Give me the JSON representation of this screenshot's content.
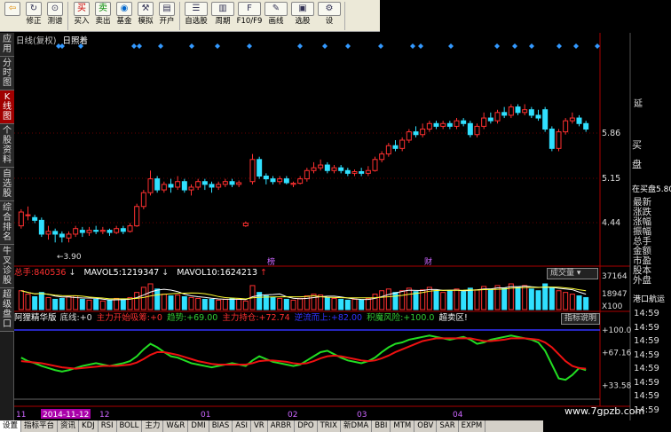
{
  "toolbar": {
    "title": "",
    "groups": [
      [
        {
          "icon": "back",
          "label": ""
        },
        {
          "icon": "forward",
          "label": "修正"
        },
        {
          "icon": "target",
          "label": "测谱"
        }
      ],
      [
        {
          "icon": "buy",
          "label": "买入"
        },
        {
          "icon": "sell",
          "label": "卖出"
        },
        {
          "icon": "fund",
          "label": "基金"
        },
        {
          "icon": "hammer",
          "label": "模拟"
        },
        {
          "icon": "book",
          "label": "开户"
        }
      ],
      [
        {
          "icon": "list",
          "label": "自选股"
        },
        {
          "icon": "bars",
          "label": "周期"
        },
        {
          "icon": "f10",
          "label": "F10/F9"
        },
        {
          "icon": "pen",
          "label": "画线"
        },
        {
          "icon": "screen",
          "label": "选股"
        },
        {
          "icon": "more",
          "label": "设"
        }
      ]
    ]
  },
  "left_tabs": [
    "应用",
    "分时图",
    "K线图",
    "个股资料",
    "自选股",
    "综合排名",
    "牛叉诊股",
    "超级盘口"
  ],
  "chart_header": {
    "period": "日线(复权)",
    "mode": "日照着"
  },
  "price_axis": [
    "5.86",
    "5.15",
    "4.44"
  ],
  "low_label": "3.90",
  "markers": [
    "榜",
    "财"
  ],
  "volume": {
    "label": "总手:",
    "value": "840536",
    "ma5_label": "MAVOL5:",
    "ma5": "1219347",
    "ma10_label": "MAVOL10:",
    "ma10": "1624213",
    "button": "成交量",
    "axis": [
      "37164",
      "18947",
      "X100"
    ]
  },
  "indicator": {
    "name": "阿狸精华版",
    "items": [
      {
        "label": "底线:",
        "value": "+0"
      },
      {
        "label": "主力开始吸筹:",
        "value": "+0"
      },
      {
        "label": "趋势:",
        "value": "+69.00"
      },
      {
        "label": "主力持仓:",
        "value": "+72.74"
      },
      {
        "label": "逆流而上:",
        "value": "+82.00"
      },
      {
        "label": "积魔风险:",
        "value": "+100.0"
      },
      {
        "label": "超卖区!",
        "value": ""
      }
    ],
    "button": "指标说明",
    "axis": [
      "+100.0",
      "+67.16",
      "+33.58"
    ]
  },
  "right_panel": {
    "top": [
      "延",
      "买",
      "盘"
    ],
    "buy_label": "在买盘5.80",
    "items": [
      "最新",
      "涨跌",
      "涨幅",
      "振幅",
      "总手",
      "金额",
      "市盈",
      "股本",
      "外盘"
    ],
    "port": "港口航运",
    "times": [
      "14:59",
      "14:59",
      "14:59",
      "14:59",
      "14:59",
      "14:59",
      "14:59",
      "14:59"
    ]
  },
  "date_axis": {
    "labels": [
      "11",
      "2014-11-12",
      "12",
      "01",
      "02",
      "03",
      "04"
    ]
  },
  "bottom_tabs": [
    "设置",
    "指标平台",
    "资讯",
    "KDJ",
    "RSI",
    "BOLL",
    "主力",
    "W&R",
    "DMI",
    "BIAS",
    "ASI",
    "VR",
    "ARBR",
    "DPO",
    "TRIX",
    "新DMA",
    "BBI",
    "MTM",
    "OBV",
    "SAR",
    "EXPM"
  ],
  "watermark": "www.7gpzb.com",
  "chart_data": {
    "type": "candlestick",
    "price_range": [
      3.6,
      6.6
    ],
    "candles": [
      [
        4.2,
        4.45,
        4.15,
        4.5
      ],
      [
        4.4,
        4.4,
        4.3,
        4.55
      ],
      [
        4.35,
        4.3,
        4.25,
        4.4
      ],
      [
        4.3,
        4.05,
        4.0,
        4.35
      ],
      [
        4.05,
        4.1,
        3.95,
        4.2
      ],
      [
        4.1,
        4.05,
        3.9,
        4.15
      ],
      [
        4.05,
        4.0,
        3.9,
        4.1
      ],
      [
        3.98,
        4.05,
        3.9,
        4.1
      ],
      [
        4.05,
        4.15,
        4.0,
        4.2
      ],
      [
        4.12,
        4.08,
        4.0,
        4.18
      ],
      [
        4.08,
        4.12,
        4.02,
        4.18
      ],
      [
        4.12,
        4.1,
        4.05,
        4.2
      ],
      [
        4.1,
        4.12,
        4.05,
        4.18
      ],
      [
        4.12,
        4.08,
        4.02,
        4.15
      ],
      [
        4.08,
        4.15,
        4.05,
        4.2
      ],
      [
        4.15,
        4.1,
        4.05,
        4.2
      ],
      [
        4.1,
        4.2,
        4.08,
        4.25
      ],
      [
        4.2,
        4.55,
        4.18,
        4.6
      ],
      [
        4.55,
        4.8,
        4.5,
        4.85
      ],
      [
        4.8,
        5.05,
        4.75,
        5.2
      ],
      [
        5.05,
        4.85,
        4.8,
        5.1
      ],
      [
        4.85,
        4.95,
        4.8,
        5.0
      ],
      [
        4.95,
        4.9,
        4.8,
        5.05
      ],
      [
        4.9,
        5.0,
        4.85,
        5.1
      ],
      [
        5.0,
        4.85,
        4.8,
        5.05
      ],
      [
        4.85,
        4.9,
        4.75,
        4.95
      ],
      [
        4.9,
        5.0,
        4.85,
        5.05
      ],
      [
        5.0,
        4.95,
        4.85,
        5.05
      ],
      [
        4.95,
        4.9,
        4.8,
        5.0
      ],
      [
        4.9,
        4.95,
        4.85,
        5.0
      ],
      [
        4.95,
        5.0,
        4.9,
        5.05
      ],
      [
        5.0,
        4.95,
        4.9,
        5.05
      ],
      [
        4.95,
        4.98,
        4.9,
        5.02
      ],
      [
        4.2,
        4.25,
        4.18,
        4.28
      ],
      [
        5.0,
        5.4,
        4.95,
        5.5
      ],
      [
        5.4,
        5.1,
        5.05,
        5.45
      ],
      [
        5.1,
        5.05,
        4.95,
        5.15
      ],
      [
        5.05,
        5.0,
        4.95,
        5.1
      ],
      [
        5.0,
        5.05,
        4.95,
        5.1
      ],
      [
        5.05,
        4.98,
        4.95,
        5.1
      ],
      [
        4.95,
        4.97,
        4.9,
        5.0
      ],
      [
        4.97,
        5.05,
        4.95,
        5.1
      ],
      [
        5.05,
        5.2,
        5.0,
        5.25
      ],
      [
        5.2,
        5.25,
        5.15,
        5.35
      ],
      [
        5.25,
        5.3,
        5.2,
        5.4
      ],
      [
        5.3,
        5.2,
        5.15,
        5.35
      ],
      [
        5.2,
        5.25,
        5.15,
        5.3
      ],
      [
        5.25,
        5.2,
        5.15,
        5.3
      ],
      [
        5.2,
        5.15,
        5.1,
        5.25
      ],
      [
        5.15,
        5.18,
        5.1,
        5.22
      ],
      [
        5.18,
        5.15,
        5.1,
        5.25
      ],
      [
        5.15,
        5.2,
        5.1,
        5.28
      ],
      [
        5.2,
        5.4,
        5.18,
        5.45
      ],
      [
        5.4,
        5.5,
        5.35,
        5.55
      ],
      [
        5.5,
        5.65,
        5.45,
        5.7
      ],
      [
        5.65,
        5.6,
        5.55,
        5.75
      ],
      [
        5.6,
        5.75,
        5.55,
        5.8
      ],
      [
        5.75,
        5.9,
        5.7,
        5.95
      ],
      [
        5.9,
        5.85,
        5.8,
        6.0
      ],
      [
        5.85,
        5.95,
        5.8,
        6.05
      ],
      [
        5.95,
        6.05,
        5.9,
        6.1
      ],
      [
        6.05,
        6.0,
        5.95,
        6.1
      ],
      [
        6.0,
        6.05,
        5.95,
        6.1
      ],
      [
        6.05,
        6.0,
        5.95,
        6.1
      ],
      [
        6.0,
        6.1,
        5.95,
        6.15
      ],
      [
        6.1,
        6.05,
        6.0,
        6.15
      ],
      [
        6.05,
        5.85,
        5.8,
        6.1
      ],
      [
        5.85,
        6.0,
        5.8,
        6.05
      ],
      [
        6.0,
        6.15,
        5.95,
        6.25
      ],
      [
        6.15,
        6.1,
        6.05,
        6.25
      ],
      [
        6.1,
        6.25,
        6.05,
        6.3
      ],
      [
        6.25,
        6.2,
        6.15,
        6.35
      ],
      [
        6.2,
        6.35,
        6.15,
        6.4
      ],
      [
        6.35,
        6.25,
        6.2,
        6.4
      ],
      [
        6.25,
        6.3,
        6.2,
        6.4
      ],
      [
        6.3,
        6.2,
        6.15,
        6.35
      ],
      [
        6.2,
        6.15,
        6.1,
        6.3
      ],
      [
        6.3,
        5.95,
        5.9,
        6.35
      ],
      [
        5.95,
        5.6,
        5.55,
        6.0
      ],
      [
        5.6,
        5.9,
        5.55,
        5.95
      ],
      [
        5.9,
        6.1,
        5.85,
        6.15
      ],
      [
        6.1,
        6.15,
        6.05,
        6.25
      ],
      [
        6.15,
        6.05,
        6.0,
        6.2
      ],
      [
        6.05,
        5.95,
        5.9,
        6.1
      ]
    ],
    "volume": [
      22,
      18,
      15,
      20,
      14,
      12,
      13,
      15,
      16,
      12,
      11,
      12,
      10,
      11,
      13,
      12,
      14,
      20,
      26,
      30,
      24,
      18,
      16,
      17,
      15,
      14,
      13,
      12,
      12,
      11,
      12,
      13,
      12,
      10,
      28,
      20,
      16,
      14,
      13,
      12,
      11,
      13,
      16,
      18,
      17,
      14,
      13,
      12,
      11,
      12,
      11,
      13,
      18,
      22,
      24,
      20,
      22,
      25,
      21,
      23,
      26,
      22,
      20,
      22,
      24,
      21,
      25,
      23,
      27,
      24,
      28,
      25,
      30,
      26,
      28,
      24,
      22,
      30,
      26,
      22,
      20,
      18,
      16,
      14
    ],
    "k_line": [
      60,
      55,
      52,
      48,
      45,
      42,
      40,
      42,
      45,
      48,
      50,
      52,
      50,
      48,
      50,
      52,
      55,
      62,
      72,
      80,
      75,
      68,
      62,
      60,
      56,
      52,
      50,
      48,
      46,
      48,
      50,
      52,
      50,
      48,
      56,
      62,
      58,
      54,
      52,
      50,
      48,
      50,
      56,
      62,
      68,
      70,
      65,
      60,
      56,
      54,
      52,
      55,
      60,
      68,
      75,
      80,
      82,
      86,
      88,
      90,
      92,
      90,
      88,
      86,
      88,
      90,
      86,
      80,
      82,
      86,
      88,
      90,
      92,
      90,
      88,
      86,
      82,
      70,
      50,
      30,
      28,
      35,
      45,
      42
    ],
    "d_line": [
      55,
      54,
      53,
      52,
      50,
      48,
      46,
      45,
      44,
      45,
      46,
      47,
      48,
      48,
      48,
      49,
      50,
      53,
      58,
      64,
      68,
      68,
      66,
      64,
      61,
      58,
      55,
      53,
      51,
      50,
      50,
      50,
      50,
      50,
      52,
      55,
      56,
      56,
      55,
      54,
      52,
      51,
      52,
      55,
      59,
      62,
      63,
      62,
      60,
      58,
      56,
      55,
      56,
      59,
      63,
      68,
      72,
      76,
      80,
      84,
      86,
      88,
      88,
      88,
      88,
      88,
      88,
      86,
      84,
      84,
      85,
      86,
      88,
      88,
      88,
      87,
      86,
      82,
      75,
      65,
      55,
      48,
      45,
      44
    ]
  }
}
